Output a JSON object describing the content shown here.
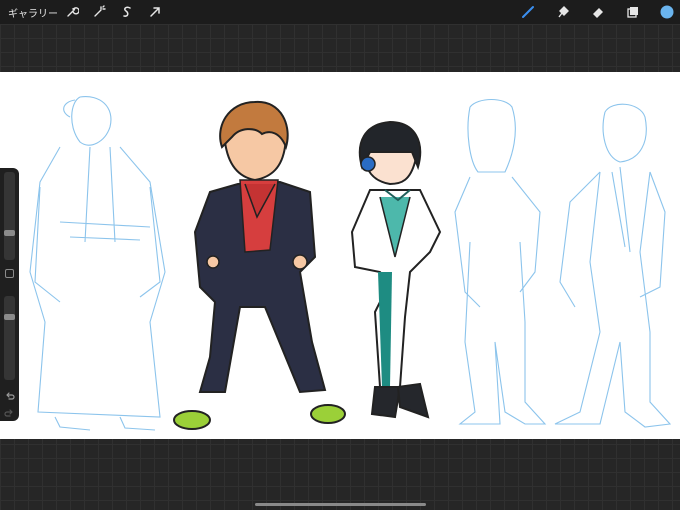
{
  "toolbar": {
    "gallery_label": "ギャラリー",
    "left_tools": [
      "wrench-icon",
      "magic-wand-icon",
      "selection-s-icon",
      "transform-arrow-icon"
    ],
    "right_tools": [
      "brush-icon",
      "smudge-icon",
      "eraser-icon",
      "layers-icon",
      "color-swatch"
    ],
    "active_tool": "brush-icon",
    "active_color": "#6ab4ee",
    "accent": "#3b8ff0"
  },
  "sidebar": {
    "brush_size_level": 0.35,
    "opacity_level": 0.3,
    "icons": [
      "modify-square-icon",
      "undo-icon",
      "redo-icon"
    ]
  },
  "canvas": {
    "background": "#ffffff",
    "sketch_color": "#8cc4ec"
  }
}
